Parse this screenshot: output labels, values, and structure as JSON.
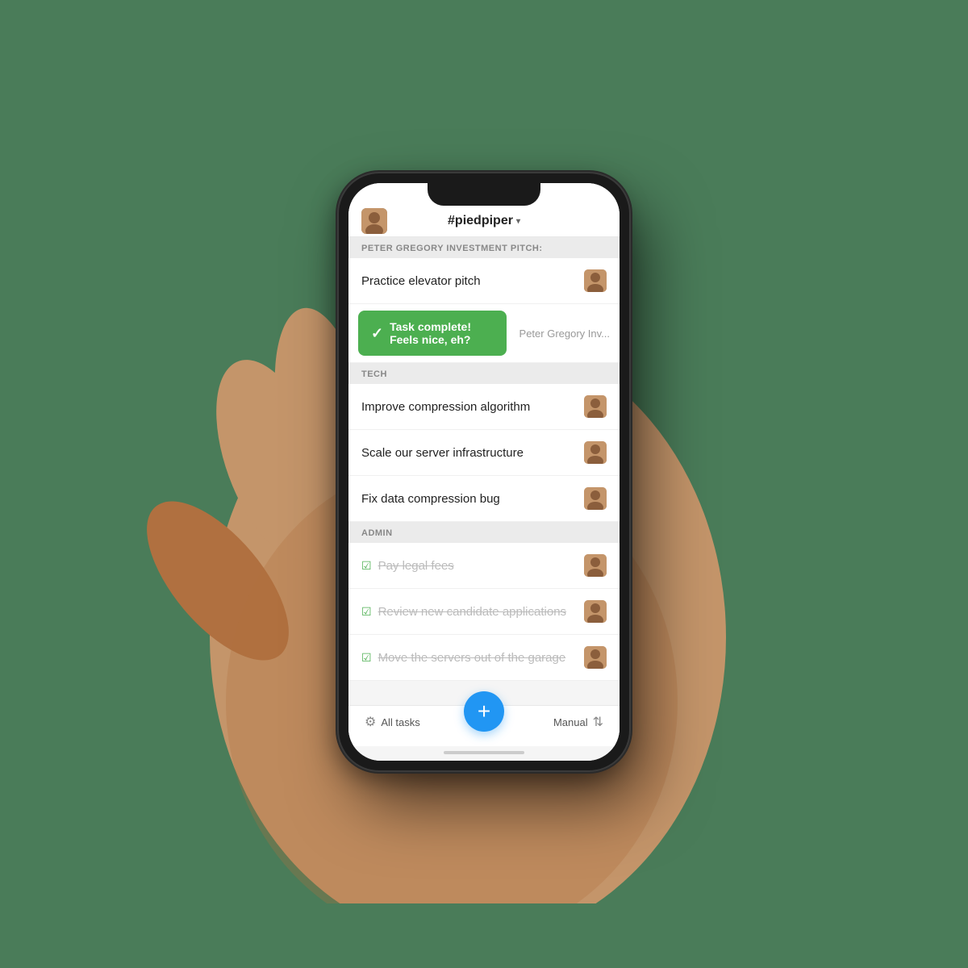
{
  "app": {
    "background_color": "#4a8c5c"
  },
  "header": {
    "title": "#piedpiper",
    "chevron": "▾",
    "avatar_alt": "user avatar"
  },
  "sections": [
    {
      "id": "peter-gregory",
      "label": "PETER GREGORY INVESTMENT PITCH:",
      "tasks": [
        {
          "id": "task-1",
          "text": "Practice elevator pitch",
          "completed": false,
          "has_avatar": true
        },
        {
          "id": "task-2",
          "text": "Peter Gregory Inv...",
          "completed": false,
          "is_toast_row": true,
          "toast_text": "Task complete! Feels nice, eh?"
        }
      ]
    },
    {
      "id": "tech",
      "label": "TECH",
      "tasks": [
        {
          "id": "task-3",
          "text": "Improve compression algorithm",
          "completed": false,
          "has_avatar": true
        },
        {
          "id": "task-4",
          "text": "Scale our server infrastructure",
          "completed": false,
          "has_avatar": true
        },
        {
          "id": "task-5",
          "text": "Fix data compression bug",
          "completed": false,
          "has_avatar": true
        }
      ]
    },
    {
      "id": "admin",
      "label": "ADMIN",
      "tasks": [
        {
          "id": "task-6",
          "text": "Pay legal fees",
          "completed": true,
          "has_avatar": true
        },
        {
          "id": "task-7",
          "text": "Review new candidate applications",
          "completed": true,
          "has_avatar": true
        },
        {
          "id": "task-8",
          "text": "Move the servers out of the garage",
          "completed": true,
          "has_avatar": true
        }
      ]
    }
  ],
  "bottom_nav": {
    "left_label": "All tasks",
    "right_label": "Manual",
    "fab_icon": "+"
  },
  "toast": {
    "message": "Task complete! Feels nice, eh?",
    "check_icon": "✓"
  }
}
